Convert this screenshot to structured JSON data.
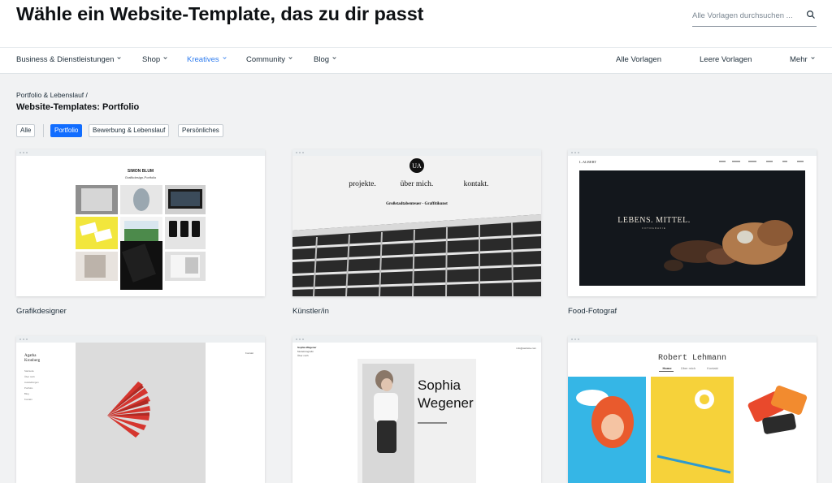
{
  "header": {
    "title": "Wähle ein Website-Template, das zu dir passt",
    "search_placeholder": "Alle Vorlagen durchsuchen ..."
  },
  "nav": {
    "items": [
      {
        "label": "Business & Dienstleistungen"
      },
      {
        "label": "Shop"
      },
      {
        "label": "Kreatives",
        "active": true
      },
      {
        "label": "Community"
      },
      {
        "label": "Blog"
      }
    ],
    "right": [
      {
        "label": "Alle Vorlagen"
      },
      {
        "label": "Leere Vorlagen"
      },
      {
        "label": "Mehr"
      }
    ]
  },
  "breadcrumb": "Portfolio & Lebenslauf /",
  "section_title": "Website-Templates: Portfolio",
  "filters": [
    {
      "label": "Alle"
    },
    {
      "label": "Portfolio",
      "active": true
    },
    {
      "label": "Bewerbung & Lebenslauf"
    },
    {
      "label": "Persönliches"
    }
  ],
  "cards": [
    {
      "label": "Grafikdesigner",
      "preview": {
        "name": "SIMON BLUM",
        "subtitle": "Grafikdesign-Portfolio"
      }
    },
    {
      "label": "Künstler/in",
      "preview": {
        "logo": "UA",
        "links": [
          "projekte.",
          "über mich.",
          "kontakt."
        ],
        "tagline": "Großstadtabenteuer - Graffitikunst"
      }
    },
    {
      "label": "Food-Fotograf",
      "preview": {
        "brand": "L.ALBERT",
        "headline": "LEBENS. MITTEL.",
        "sub": "FOTOGRAFIE"
      }
    },
    {
      "label": "",
      "preview": {
        "name_line1": "Agatha",
        "name_line2": "Kronberg",
        "menu": [
          "Startseite",
          "Über mich",
          "Ausstellungen",
          "Portfolio",
          "Blog",
          "Kontakt"
        ],
        "corner": "Kontakt"
      }
    },
    {
      "label": "",
      "preview": {
        "name_line1": "Sophia",
        "name_line2": "Wegener",
        "top_left_1": "Sophia Wegener",
        "top_left_2": "Modefotografin",
        "top_left_3": "Über mich",
        "top_right": "info@website.com"
      }
    },
    {
      "label": "",
      "preview": {
        "name": "Robert Lehmann",
        "links": [
          "Home",
          "Über mich",
          "Kontakt"
        ]
      }
    }
  ],
  "colors": {
    "accent": "#116dff",
    "nav_active": "#2e7cef",
    "background": "#f1f2f3"
  }
}
